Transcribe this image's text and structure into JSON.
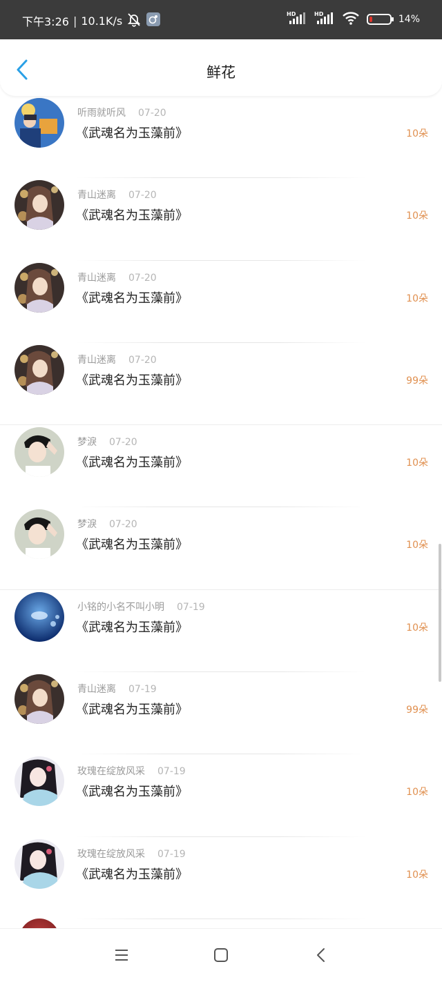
{
  "status_bar": {
    "time": "下午3:26",
    "separator": "|",
    "speed": "10.1K/s",
    "battery": "14%",
    "battery_level": 0.14,
    "icons": [
      "mute-bell-icon",
      "app-notification-icon",
      "hd-signal-icon",
      "hd-signal-icon",
      "wifi-icon",
      "battery-icon"
    ]
  },
  "header": {
    "title": "鲜花",
    "back_icon": "chevron-left-icon"
  },
  "colors": {
    "accent_blue": "#2aa0e6",
    "amount_orange": "#e09050",
    "status_bg": "#3b3b3b"
  },
  "records": [
    {
      "user": "听雨就听风",
      "date": "07-20",
      "book": "《武魂名为玉藻前》",
      "amount": "10朵",
      "avatar": "blue-scene"
    },
    {
      "user": "青山迷离",
      "date": "07-20",
      "book": "《武魂名为玉藻前》",
      "amount": "10朵",
      "avatar": "girl-lights"
    },
    {
      "user": "青山迷离",
      "date": "07-20",
      "book": "《武魂名为玉藻前》",
      "amount": "10朵",
      "avatar": "girl-lights"
    },
    {
      "user": "青山迷离",
      "date": "07-20",
      "book": "《武魂名为玉藻前》",
      "amount": "99朵",
      "avatar": "girl-lights"
    },
    {
      "user": "梦淚",
      "date": "07-20",
      "book": "《武魂名为玉藻前》",
      "amount": "10朵",
      "avatar": "boy"
    },
    {
      "user": "梦淚",
      "date": "07-20",
      "book": "《武魂名为玉藻前》",
      "amount": "10朵",
      "avatar": "boy"
    },
    {
      "user": "小铭的小名不叫小明",
      "date": "07-19",
      "book": "《武魂名为玉藻前》",
      "amount": "10朵",
      "avatar": "blue-water"
    },
    {
      "user": "青山迷离",
      "date": "07-19",
      "book": "《武魂名为玉藻前》",
      "amount": "99朵",
      "avatar": "girl-lights"
    },
    {
      "user": "玫瑰在绽放风采",
      "date": "07-19",
      "book": "《武魂名为玉藻前》",
      "amount": "10朵",
      "avatar": "hanfu-girl"
    },
    {
      "user": "玫瑰在绽放风采",
      "date": "07-19",
      "book": "《武魂名为玉藻前》",
      "amount": "10朵",
      "avatar": "hanfu-girl"
    }
  ],
  "nav_bar": {
    "icons": [
      "menu-icon",
      "home-square-icon",
      "back-arrow-icon"
    ]
  }
}
